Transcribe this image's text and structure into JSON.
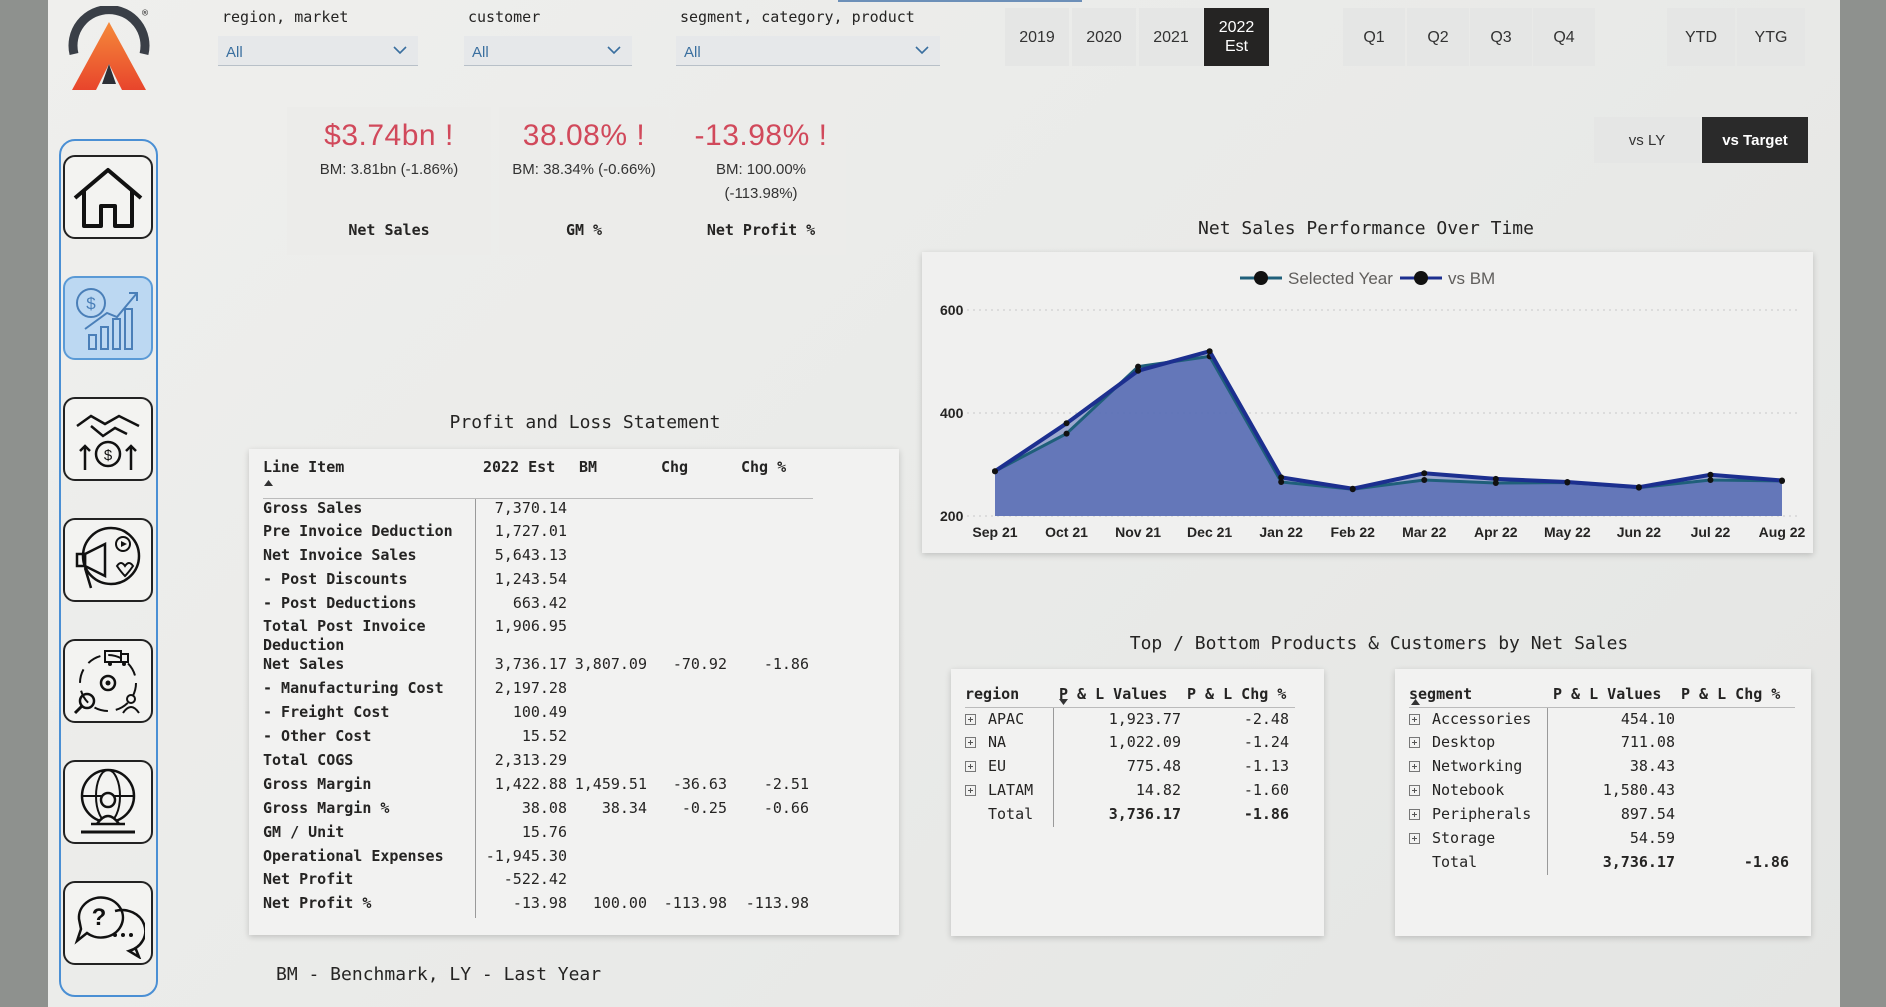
{
  "logo": {
    "registered_mark": "®"
  },
  "filters": {
    "region": {
      "label": "region, market",
      "value": "All"
    },
    "customer": {
      "label": "customer",
      "value": "All"
    },
    "segment": {
      "label": "segment, category, product",
      "value": "All"
    }
  },
  "years": [
    "2019",
    "2020",
    "2021"
  ],
  "active_year": {
    "line1": "2022",
    "line2": "Est"
  },
  "quarters": [
    "Q1",
    "Q2",
    "Q3",
    "Q4"
  ],
  "periods": [
    "YTD",
    "YTG"
  ],
  "comparison": {
    "vs_ly": "vs LY",
    "vs_target": "vs Target"
  },
  "nav": {
    "items": [
      "home-icon",
      "finance-growth-icon",
      "handshake-money-icon",
      "marketing-megaphone-icon",
      "supply-chain-icon",
      "global-business-icon",
      "help-chat-icon"
    ],
    "active_index": 1
  },
  "kpis": [
    {
      "value": "$3.74bn",
      "alert": "!",
      "bm": "BM: 3.81bn (-1.86%)",
      "bm2": "",
      "title": "Net Sales"
    },
    {
      "value": "38.08%",
      "alert": "!",
      "bm": "BM: 38.34% (-0.66%)",
      "bm2": "",
      "title": "GM %"
    },
    {
      "value": "-13.98%",
      "alert": "!",
      "bm": "BM: 100.00%",
      "bm2": "(-113.98%)",
      "title": "Net Profit %"
    }
  ],
  "pl": {
    "title": "Profit and Loss Statement",
    "columns": [
      "Line Item",
      "2022 Est",
      "BM",
      "Chg",
      "Chg %"
    ],
    "rows": [
      [
        "Gross Sales",
        "7,370.14",
        "",
        "",
        ""
      ],
      [
        "Pre Invoice Deduction",
        "1,727.01",
        "",
        "",
        ""
      ],
      [
        "Net Invoice Sales",
        "5,643.13",
        "",
        "",
        ""
      ],
      [
        "- Post Discounts",
        "1,243.54",
        "",
        "",
        ""
      ],
      [
        "- Post Deductions",
        "663.42",
        "",
        "",
        ""
      ],
      [
        "Total Post Invoice Deduction",
        "1,906.95",
        "",
        "",
        ""
      ],
      [
        "Net Sales",
        "3,736.17",
        "3,807.09",
        "-70.92",
        "-1.86"
      ],
      [
        "- Manufacturing Cost",
        "2,197.28",
        "",
        "",
        ""
      ],
      [
        "- Freight Cost",
        "100.49",
        "",
        "",
        ""
      ],
      [
        "- Other Cost",
        "15.52",
        "",
        "",
        ""
      ],
      [
        "Total COGS",
        "2,313.29",
        "",
        "",
        ""
      ],
      [
        "Gross Margin",
        "1,422.88",
        "1,459.51",
        "-36.63",
        "-2.51"
      ],
      [
        "Gross Margin %",
        "38.08",
        "38.34",
        "-0.25",
        "-0.66"
      ],
      [
        "GM / Unit",
        "15.76",
        "",
        "",
        ""
      ],
      [
        "Operational Expenses",
        "-1,945.30",
        "",
        "",
        ""
      ],
      [
        "Net Profit",
        "-522.42",
        "",
        "",
        ""
      ],
      [
        "Net Profit %",
        "-13.98",
        "100.00",
        "-113.98",
        "-113.98"
      ]
    ]
  },
  "footnote": "BM - Benchmark, LY - Last Year",
  "chart_data": {
    "type": "area",
    "title": "Net Sales Performance Over Time",
    "categories": [
      "Sep 21",
      "Oct 21",
      "Nov 21",
      "Dec 21",
      "Jan 22",
      "Feb 22",
      "Mar 22",
      "Apr 22",
      "May 22",
      "Jun 22",
      "Jul 22",
      "Aug 22"
    ],
    "series": [
      {
        "name": "Selected Year",
        "values": [
          287,
          360,
          490,
          510,
          266,
          252,
          270,
          264,
          265,
          255,
          270,
          268
        ],
        "color": "#1f5f7a"
      },
      {
        "name": "vs BM",
        "values": [
          287,
          380,
          482,
          520,
          275,
          253,
          283,
          272,
          266,
          256,
          280,
          269
        ],
        "color": "#1c2f8f"
      }
    ],
    "fill_color": "#5a6fb5",
    "yticks": [
      200,
      400,
      600
    ],
    "ylim": [
      200,
      600
    ],
    "grid": true,
    "legend": "top-center"
  },
  "topbottom": {
    "title": "Top / Bottom Products & Customers by Net Sales",
    "region": {
      "columns": [
        "region",
        "P & L Values",
        "P & L Chg %"
      ],
      "rows": [
        [
          "APAC",
          "1,923.77",
          "-2.48"
        ],
        [
          "NA",
          "1,022.09",
          "-1.24"
        ],
        [
          "EU",
          "775.48",
          "-1.13"
        ],
        [
          "LATAM",
          "14.82",
          "-1.60"
        ]
      ],
      "total": [
        "Total",
        "3,736.17",
        "-1.86"
      ]
    },
    "segment": {
      "columns": [
        "segment",
        "P & L Values",
        "P & L Chg %"
      ],
      "rows": [
        [
          "Accessories",
          "454.10",
          ""
        ],
        [
          "Desktop",
          "711.08",
          ""
        ],
        [
          "Networking",
          "38.43",
          ""
        ],
        [
          "Notebook",
          "1,580.43",
          ""
        ],
        [
          "Peripherals",
          "897.54",
          ""
        ],
        [
          "Storage",
          "54.59",
          ""
        ]
      ],
      "total": [
        "Total",
        "3,736.17",
        "-1.86"
      ]
    }
  }
}
